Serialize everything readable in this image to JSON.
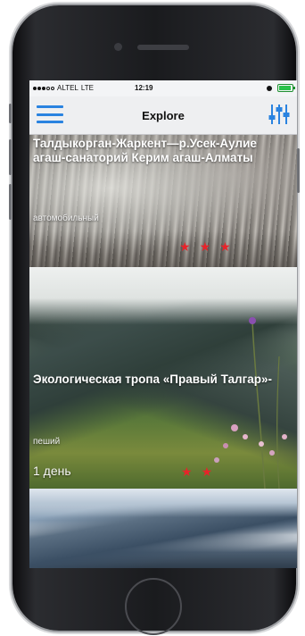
{
  "statusbar": {
    "carrier": "ALTEL",
    "network": "LTE",
    "time": "12:19"
  },
  "navbar": {
    "title": "Explore",
    "menu_icon": "hamburger-menu-icon",
    "filter_icon": "sliders-filter-icon",
    "accent_color": "#2a83e0"
  },
  "routes": [
    {
      "title": "Талдыкорган-Жаркент—р.Усек-Аулие агаш-санаторий Керим агаш-Алматы",
      "subtitle": "автомобильный",
      "rating": 3
    },
    {
      "title": "Экологическая тропа «Правый Талгар»-",
      "subtitle": "пеший",
      "duration": "1 день",
      "rating": 2
    },
    {}
  ],
  "colors": {
    "star": "#e8232a"
  }
}
